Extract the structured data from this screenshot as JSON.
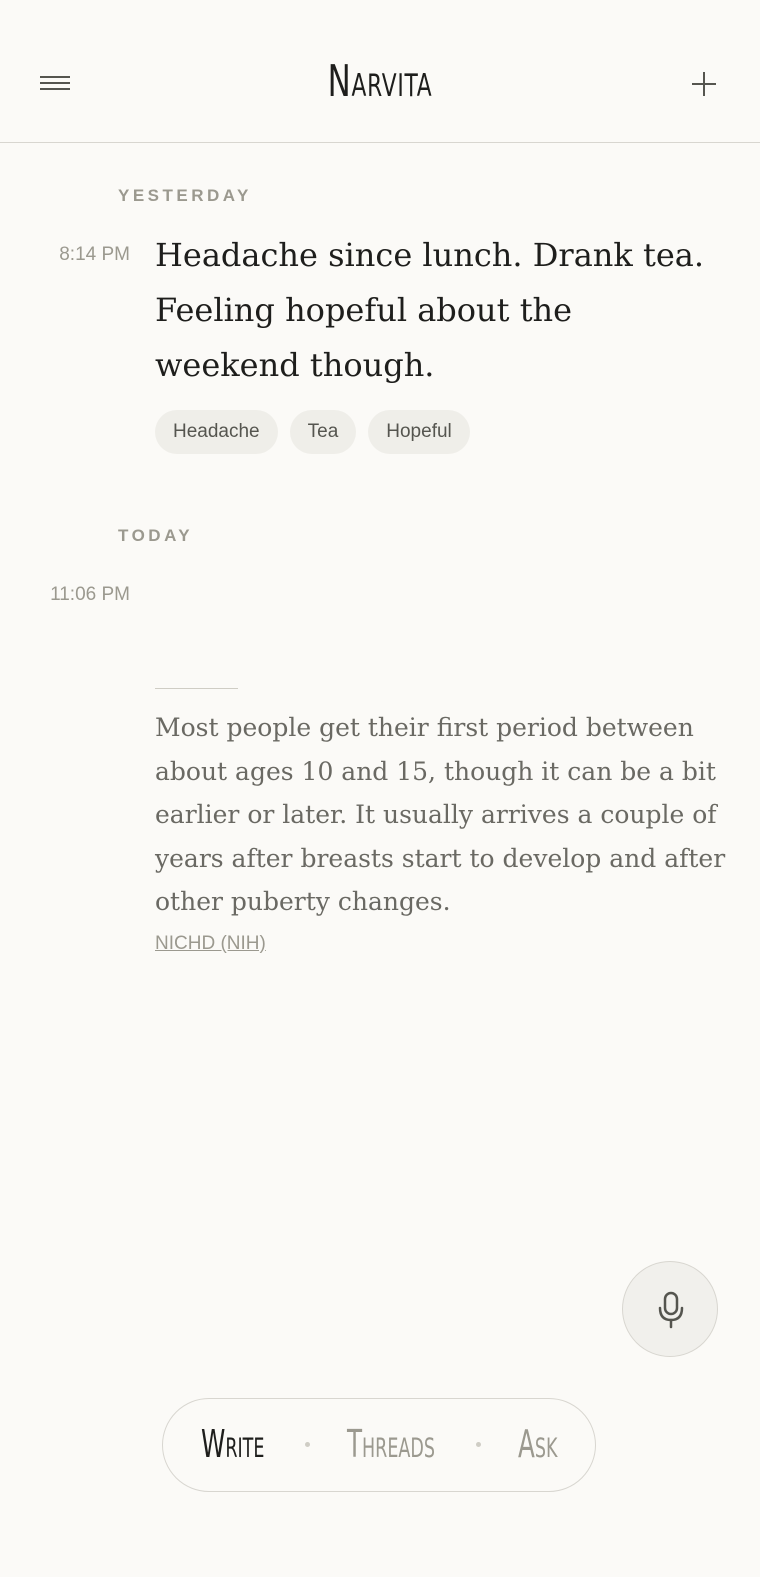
{
  "header": {
    "title": "Narvita"
  },
  "sections": [
    {
      "label": "YESTERDAY",
      "entries": [
        {
          "time": "8:14 PM",
          "text": "Headache since lunch. Drank tea. Feeling hopeful about the weekend though.",
          "tags": [
            "Headache",
            "Tea",
            "Hopeful"
          ]
        }
      ]
    },
    {
      "label": "TODAY",
      "entries": [
        {
          "time": "11:06 PM",
          "answer": "Most people get their first period between about ages 10 and 15, though it can be a bit earlier or later. It usually arrives a couple of years after breasts start to develop and after other puberty changes.",
          "source": "NICHD (NIH)"
        }
      ]
    }
  ],
  "bottom_nav": {
    "items": [
      "Write",
      "Threads",
      "Ask"
    ],
    "active": "Write"
  },
  "icons": {
    "menu": "menu-icon",
    "add": "plus-icon",
    "mic": "microphone-icon"
  },
  "colors": {
    "background": "#fbfaf7",
    "text_primary": "#1e1e1c",
    "text_muted": "#9b998f",
    "tag_background": "#efeee9"
  }
}
